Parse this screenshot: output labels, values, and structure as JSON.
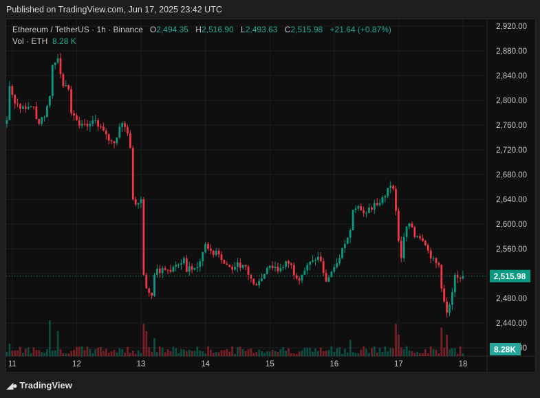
{
  "published": "Published on TradingView.com, Jun 17, 2025 23:42 UTC",
  "legend": {
    "symbol": "Ethereum / TetherUS · 1h · Binance",
    "o_label": "O",
    "o": "2,494.35",
    "h_label": "H",
    "h": "2,516.90",
    "l_label": "L",
    "l": "2,493.63",
    "c_label": "C",
    "c": "2,515.98",
    "change": "+21.64 (+0.87%)",
    "vol_label": "Vol · ETH",
    "vol": "8.28 K"
  },
  "footer": {
    "brand": "TradingView",
    "logo": "17"
  },
  "colors": {
    "up": "#089981",
    "down": "#f23645",
    "price_tag": "#089981",
    "vol_tag": "#26a69a"
  },
  "chart_data": {
    "type": "candlestick",
    "symbol": "ETHUSDT",
    "interval": "1h",
    "y_ticks": [
      "2,920.00",
      "2,880.00",
      "2,840.00",
      "2,800.00",
      "2,760.00",
      "2,720.00",
      "2,680.00",
      "2,640.00",
      "2,600.00",
      "2,560.00",
      "2,520.00",
      "2,480.00",
      "2,440.00",
      "2,400.00"
    ],
    "ylim": [
      2400,
      2920
    ],
    "x_ticks": [
      {
        "label": "11",
        "hour": 2
      },
      {
        "label": "12",
        "hour": 26
      },
      {
        "label": "13",
        "hour": 50
      },
      {
        "label": "14",
        "hour": 74
      },
      {
        "label": "15",
        "hour": 98
      },
      {
        "label": "16",
        "hour": 122
      },
      {
        "label": "17",
        "hour": 146
      },
      {
        "label": "18",
        "hour": 170
      }
    ],
    "last_price": 2515.98,
    "last_price_label": "2,515.98",
    "last_volume_label": "8.28K",
    "close_keypoints": [
      [
        0,
        2768
      ],
      [
        1,
        2823
      ],
      [
        3,
        2795
      ],
      [
        6,
        2790
      ],
      [
        10,
        2790
      ],
      [
        12,
        2762
      ],
      [
        14,
        2773
      ],
      [
        16,
        2807
      ],
      [
        17,
        2857
      ],
      [
        19,
        2868
      ],
      [
        21,
        2823
      ],
      [
        23,
        2818
      ],
      [
        24,
        2779
      ],
      [
        26,
        2768
      ],
      [
        28,
        2762
      ],
      [
        31,
        2762
      ],
      [
        33,
        2768
      ],
      [
        36,
        2751
      ],
      [
        39,
        2734
      ],
      [
        41,
        2740
      ],
      [
        42,
        2757
      ],
      [
        44,
        2757
      ],
      [
        46,
        2723
      ],
      [
        47,
        2640
      ],
      [
        49,
        2634
      ],
      [
        50,
        2640
      ],
      [
        51,
        2518
      ],
      [
        52,
        2496
      ],
      [
        54,
        2484
      ],
      [
        55,
        2518
      ],
      [
        58,
        2529
      ],
      [
        61,
        2523
      ],
      [
        63,
        2534
      ],
      [
        66,
        2545
      ],
      [
        67,
        2523
      ],
      [
        70,
        2529
      ],
      [
        72,
        2540
      ],
      [
        74,
        2568
      ],
      [
        76,
        2557
      ],
      [
        79,
        2551
      ],
      [
        80,
        2542
      ],
      [
        82,
        2534
      ],
      [
        85,
        2531
      ],
      [
        88,
        2534
      ],
      [
        90,
        2518
      ],
      [
        93,
        2501
      ],
      [
        95,
        2512
      ],
      [
        97,
        2529
      ],
      [
        99,
        2529
      ],
      [
        102,
        2529
      ],
      [
        104,
        2540
      ],
      [
        106,
        2534
      ],
      [
        108,
        2512
      ],
      [
        110,
        2518
      ],
      [
        112,
        2534
      ],
      [
        115,
        2542
      ],
      [
        117,
        2540
      ],
      [
        119,
        2507
      ],
      [
        121,
        2523
      ],
      [
        124,
        2545
      ],
      [
        126,
        2568
      ],
      [
        128,
        2590
      ],
      [
        129,
        2623
      ],
      [
        131,
        2629
      ],
      [
        134,
        2618
      ],
      [
        137,
        2634
      ],
      [
        139,
        2634
      ],
      [
        141,
        2645
      ],
      [
        143,
        2662
      ],
      [
        144,
        2657
      ],
      [
        146,
        2573
      ],
      [
        147,
        2545
      ],
      [
        148,
        2579
      ],
      [
        150,
        2601
      ],
      [
        152,
        2579
      ],
      [
        155,
        2573
      ],
      [
        157,
        2557
      ],
      [
        159,
        2545
      ],
      [
        161,
        2534
      ],
      [
        162,
        2496
      ],
      [
        164,
        2457
      ],
      [
        166,
        2490
      ],
      [
        167,
        2518
      ],
      [
        169,
        2512
      ],
      [
        170,
        2515.98
      ]
    ],
    "volume_spikes": [
      [
        1,
        0.35
      ],
      [
        16,
        1.0
      ],
      [
        19,
        0.7
      ],
      [
        51,
        0.9
      ],
      [
        52,
        0.7
      ],
      [
        55,
        0.5
      ],
      [
        128,
        0.45
      ],
      [
        145,
        0.9
      ],
      [
        146,
        0.6
      ],
      [
        162,
        0.8
      ],
      [
        164,
        0.6
      ]
    ]
  }
}
